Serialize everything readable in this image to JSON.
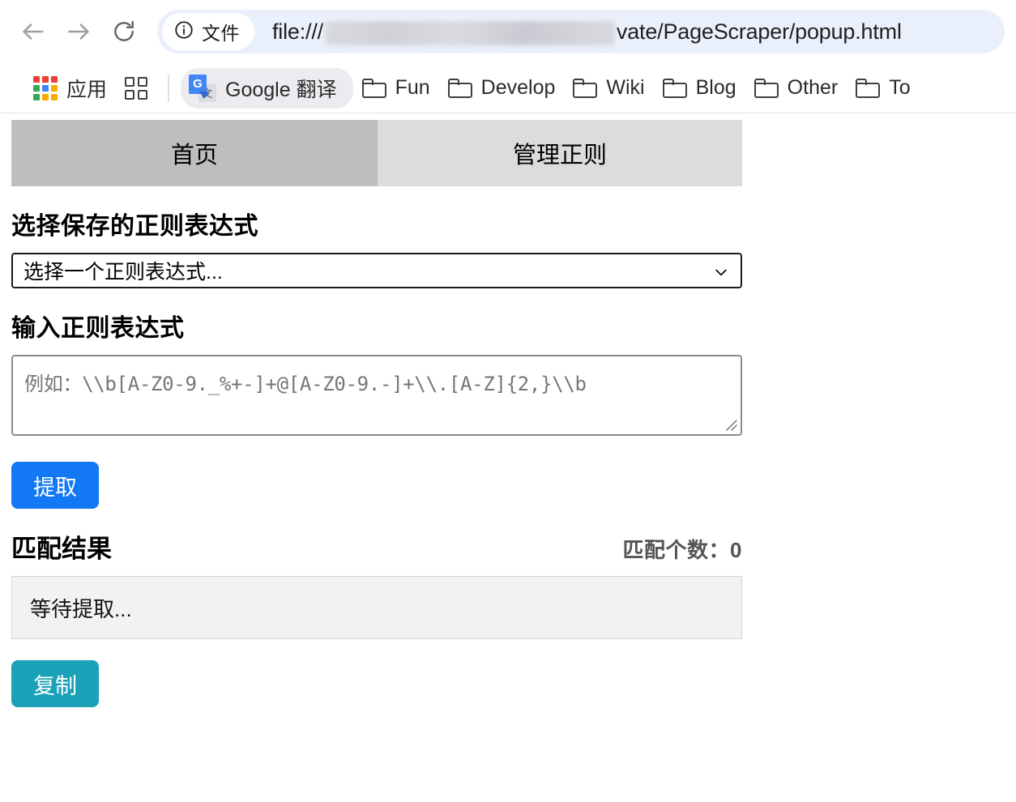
{
  "browser": {
    "back_icon": "back-arrow-icon",
    "forward_icon": "forward-arrow-icon",
    "reload_icon": "reload-icon",
    "omnibox": {
      "info_icon": "info-circle-icon",
      "scheme_badge": "文件",
      "url_prefix": "file:///",
      "url_redacted": "",
      "url_suffix": "vate/PageScraper/popup.html"
    },
    "bookmarks": {
      "apps_label": "应用",
      "apps_icon": "apps-grid-icon",
      "panel_icon": "bookmark-panel-icon",
      "items": [
        {
          "label": "Google 翻译",
          "icon": "google-translate-icon"
        },
        {
          "label": "Fun",
          "icon": "folder-icon"
        },
        {
          "label": "Develop",
          "icon": "folder-icon"
        },
        {
          "label": "Wiki",
          "icon": "folder-icon"
        },
        {
          "label": "Blog",
          "icon": "folder-icon"
        },
        {
          "label": "Other",
          "icon": "folder-icon"
        },
        {
          "label": "To",
          "icon": "folder-icon"
        }
      ]
    }
  },
  "popup": {
    "tabs": [
      {
        "label": "首页",
        "active": true
      },
      {
        "label": "管理正则",
        "active": false
      }
    ],
    "saved_regex": {
      "title": "选择保存的正则表达式",
      "selected": "选择一个正则表达式...",
      "chevron_icon": "chevron-down-icon"
    },
    "input_regex": {
      "title": "输入正则表达式",
      "value": "",
      "placeholder": "例如：\\\\b[A-Z0-9._%+-]+@[A-Z0-9.-]+\\\\.[A-Z]{2,}\\\\b",
      "resize_icon": "resize-grip-icon"
    },
    "extract_button": {
      "label": "提取",
      "color": "#1278f3"
    },
    "results": {
      "title": "匹配结果",
      "count_label": "匹配个数：0",
      "placeholder": "等待提取..."
    },
    "copy_button": {
      "label": "复制",
      "color": "#19a2b8"
    }
  }
}
